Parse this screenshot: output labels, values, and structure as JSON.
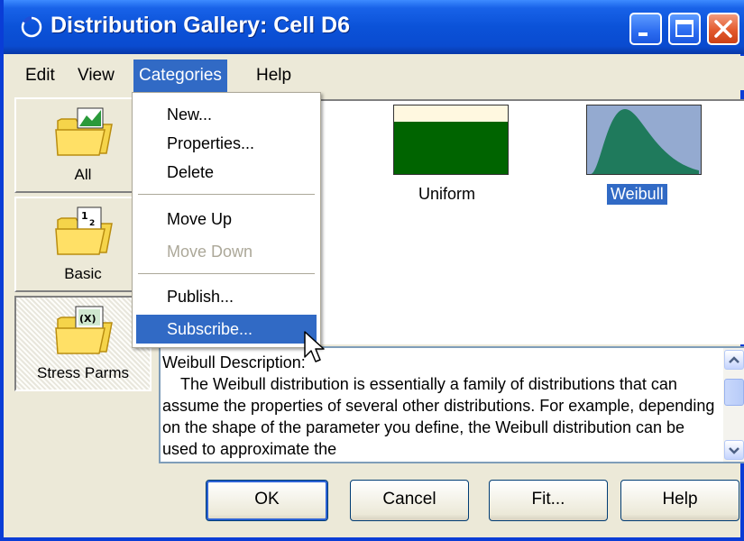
{
  "window": {
    "title": "Distribution Gallery: Cell D6",
    "controls": [
      "minimize-icon",
      "maximize-icon",
      "close-icon"
    ]
  },
  "menubar": {
    "items": [
      {
        "label": "Edit"
      },
      {
        "label": "View"
      },
      {
        "label": "Categories"
      },
      {
        "label": "Help"
      }
    ],
    "active": "Categories"
  },
  "categories_menu": {
    "items": [
      {
        "label": "New...",
        "enabled": true
      },
      {
        "label": "Properties...",
        "enabled": true
      },
      {
        "label": "Delete",
        "enabled": true
      },
      {
        "label": "Move Up",
        "enabled": true
      },
      {
        "label": "Move Down",
        "enabled": false
      },
      {
        "label": "Publish...",
        "enabled": true
      },
      {
        "label": "Subscribe...",
        "enabled": true,
        "highlighted": true
      }
    ]
  },
  "sidebar": {
    "categories": [
      {
        "label": "All",
        "icon": "folder-chart-icon"
      },
      {
        "label": "Basic",
        "icon": "folder-numbers-icon"
      },
      {
        "label": "Stress Parms",
        "icon": "folder-x-icon",
        "selected": true
      }
    ]
  },
  "gallery": {
    "distributions": [
      {
        "label": "Uniform",
        "icon": "uniform-distribution-icon"
      },
      {
        "label": "Weibull",
        "icon": "weibull-distribution-icon",
        "selected": true
      }
    ]
  },
  "description": {
    "text": "Weibull Description:\n    The Weibull distribution is essentially a family of distributions that can assume the properties of several other distributions. For example, depending on the shape of the parameter you define, the Weibull distribution can be used to approximate the"
  },
  "buttons": {
    "ok": "OK",
    "cancel": "Cancel",
    "fit": "Fit...",
    "help": "Help"
  },
  "colors": {
    "titlebar": "#0a4bd0",
    "selection": "#316ac5",
    "uniform_fill": "#006400",
    "weibull_fill": "#1f7a5c",
    "weibull_bg": "#94aad0"
  }
}
